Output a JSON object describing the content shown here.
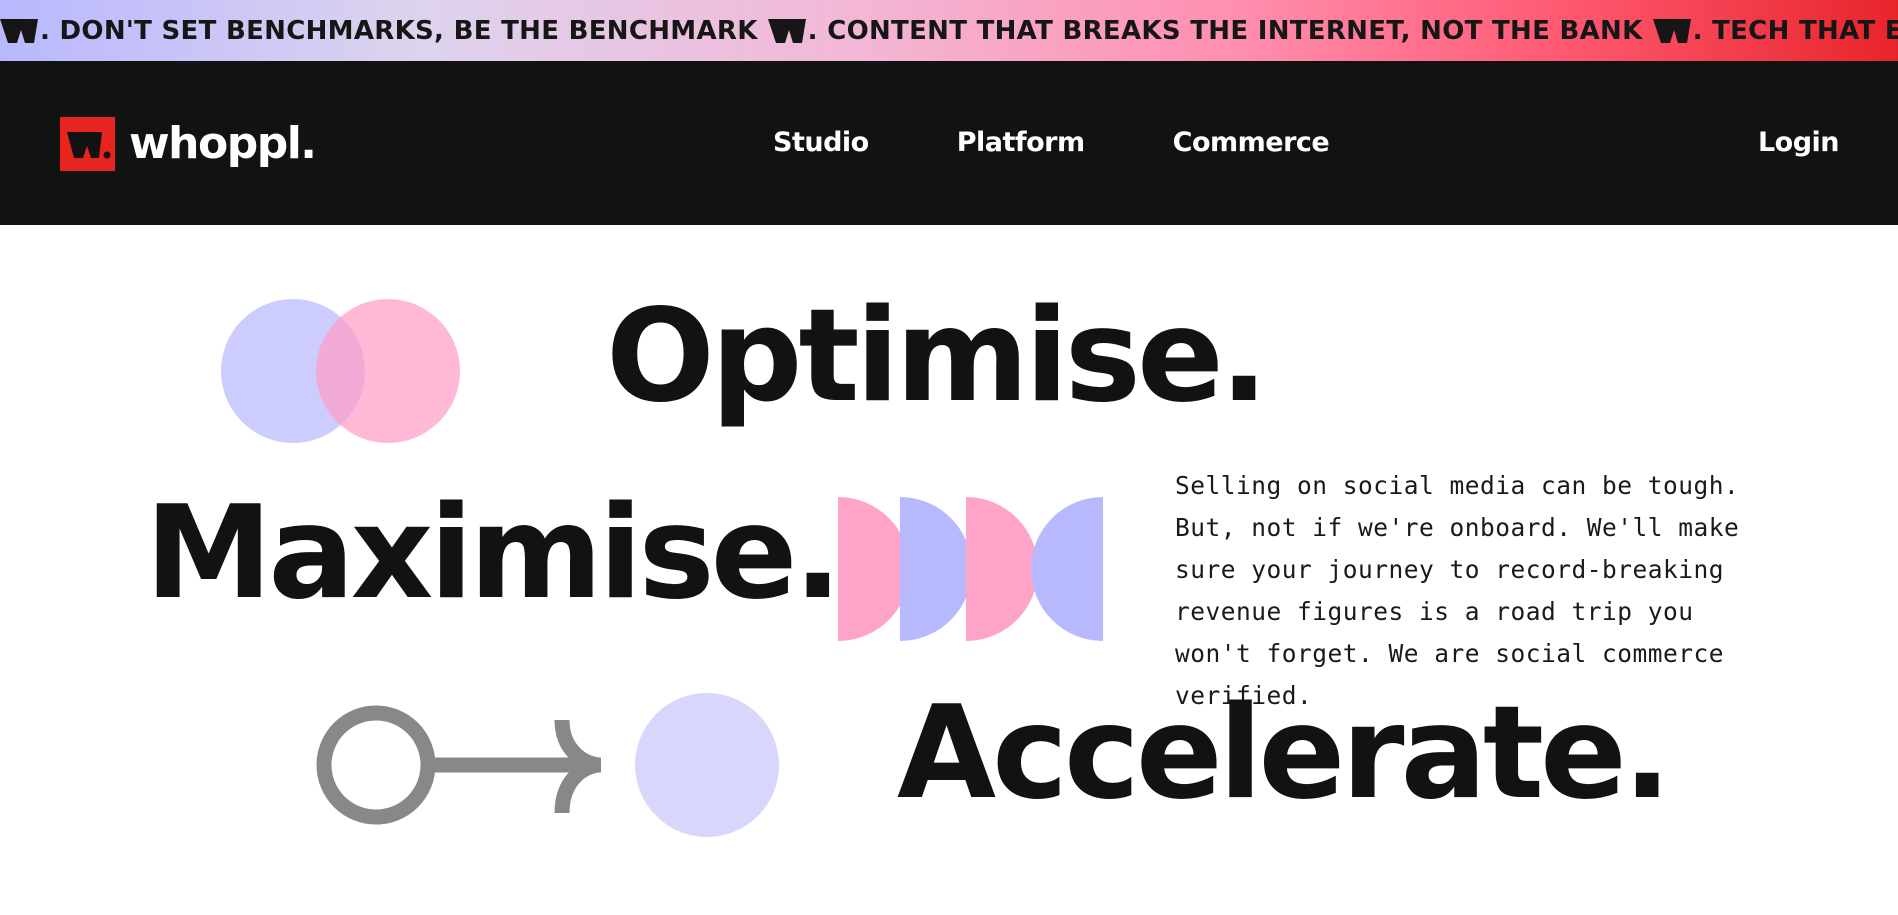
{
  "ticker": {
    "items": [
      ". DON'T SET BENCHMARKS, BE THE BENCHMARK",
      ". CONTENT THAT BREAKS THE INTERNET, NOT THE BANK",
      ". TECH THAT ELEVAT"
    ]
  },
  "navbar": {
    "brand_name": "whoppl.",
    "links": [
      "Studio",
      "Platform",
      "Commerce"
    ],
    "login_label": "Login"
  },
  "hero": {
    "word_1": "Optimise.",
    "word_2": "Maximise.",
    "word_3": "Accelerate.",
    "copy": "Selling on social media can be tough. But, not if we're onboard. We'll make sure your journey to record-breaking revenue figures is a road trip you won't forget. We are social commerce verified."
  },
  "colors": {
    "nav_bg": "#121212",
    "brand_red": "#e8241f",
    "lavender": "#b8b8ff",
    "pink": "#ffa3c8",
    "arrow_gray": "#888888",
    "text_dark": "#121212"
  },
  "icons": [
    "whoppl-logo-icon",
    "ticker-w-icon",
    "overlapping-circles-icon",
    "half-circles-icon",
    "circle-arrow-icon",
    "lavender-dot-icon"
  ]
}
